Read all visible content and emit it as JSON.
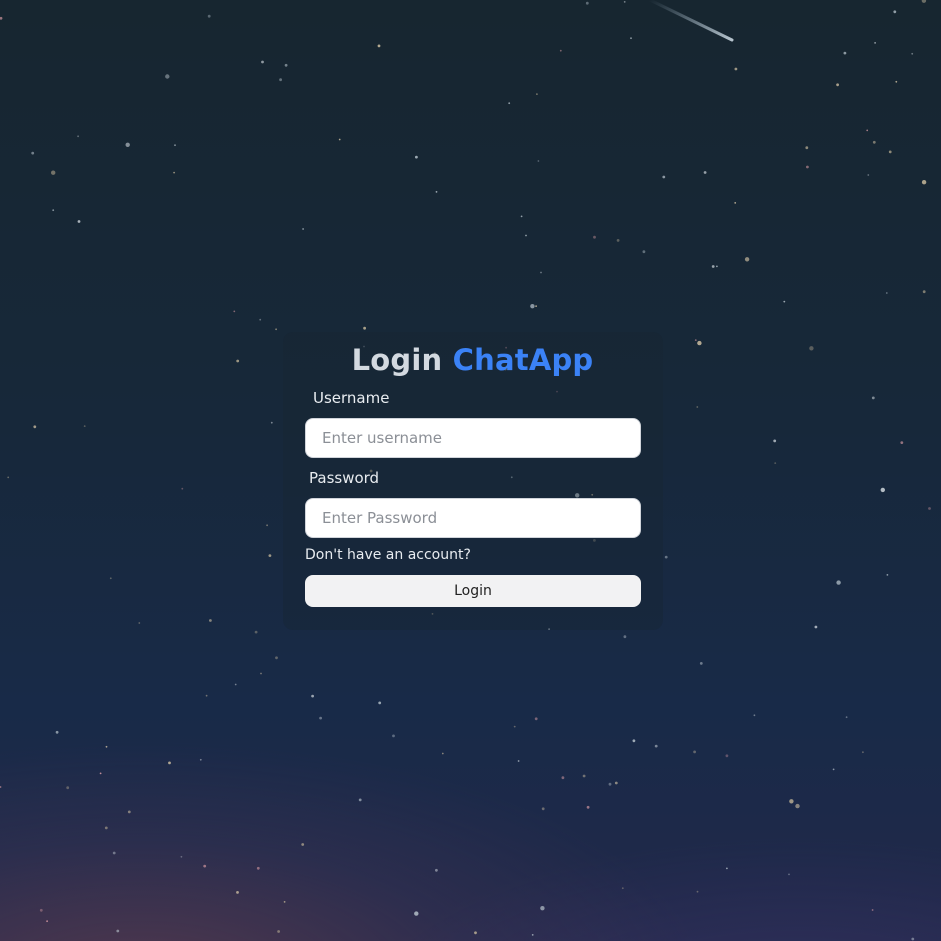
{
  "page": {
    "title_prefix": "Login",
    "title_brand": "ChatApp",
    "brand_color": "#3b82f6"
  },
  "form": {
    "username_label": "Username",
    "username_placeholder": "Enter username",
    "username_value": "",
    "password_label": "Password",
    "password_placeholder": "Enter Password",
    "password_value": "",
    "signup_link": "Don't have an account?",
    "login_button": "Login"
  },
  "background": {
    "description_icon": "starry-night-sky",
    "colors": [
      "#172630",
      "#182a48",
      "#22284a"
    ]
  }
}
